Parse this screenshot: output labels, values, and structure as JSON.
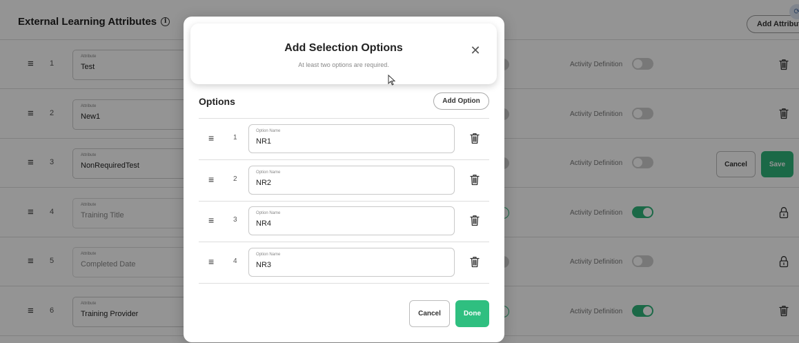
{
  "page": {
    "title": "External Learning Attributes",
    "info_icon": "info-icon",
    "add_attribute_label": "Add Attribute",
    "corner_badge_icon": "refresh-icon",
    "field_label": "Attribute",
    "activity_label": "Activity Definition",
    "rows": [
      {
        "num": "1",
        "value": "Test",
        "active": false,
        "action": "trash"
      },
      {
        "num": "2",
        "value": "New1",
        "active": false,
        "action": "trash"
      },
      {
        "num": "3",
        "value": "NonRequiredTest",
        "active": false,
        "action": "edit"
      },
      {
        "num": "4",
        "value": "Training Title",
        "active": true,
        "action": "lock"
      },
      {
        "num": "5",
        "value": "Completed Date",
        "active": false,
        "action": "lock"
      },
      {
        "num": "6",
        "value": "Training Provider",
        "active": true,
        "action": "trash"
      }
    ],
    "row_cancel_label": "Cancel",
    "row_save_label": "Save",
    "accent_color": "#2fb57a"
  },
  "modal": {
    "title": "Add Selection Options",
    "subtitle": "At least two options are required.",
    "close_icon": "close-icon",
    "options_heading": "Options",
    "add_option_label": "Add Option",
    "option_field_label": "Option Name",
    "options": [
      {
        "num": "1",
        "value": "NR1"
      },
      {
        "num": "2",
        "value": "NR2"
      },
      {
        "num": "3",
        "value": "NR4"
      },
      {
        "num": "4",
        "value": "NR3"
      }
    ],
    "cancel_label": "Cancel",
    "done_label": "Done"
  }
}
